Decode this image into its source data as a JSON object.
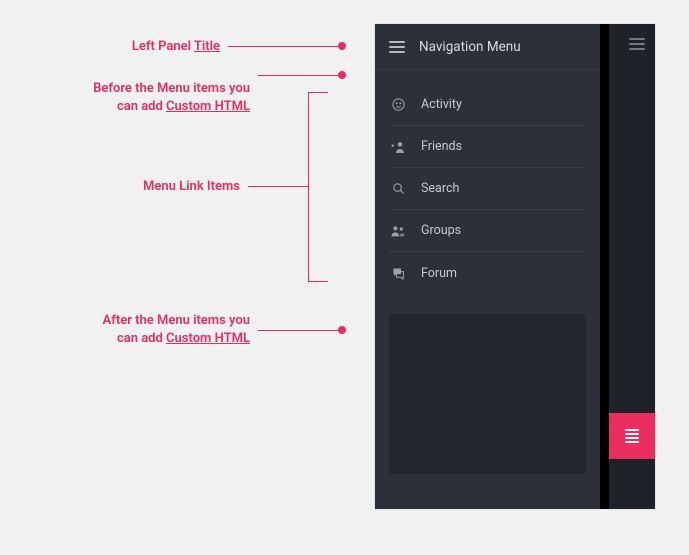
{
  "annotations": {
    "title_label": "Left Panel ",
    "title_underline": "Title",
    "before_line1": "Before the Menu items you",
    "before_line2_a": "can add ",
    "before_line2_b": "Custom HTML",
    "menu_links_label": "Menu Link Items",
    "after_line1": "After the Menu items you",
    "after_line2_a": "can add ",
    "after_line2_b": "Custom HTML"
  },
  "panel": {
    "title": "Navigation Menu",
    "items": [
      {
        "label": "Activity"
      },
      {
        "label": "Friends"
      },
      {
        "label": "Search"
      },
      {
        "label": "Groups"
      },
      {
        "label": "Forum"
      }
    ]
  }
}
